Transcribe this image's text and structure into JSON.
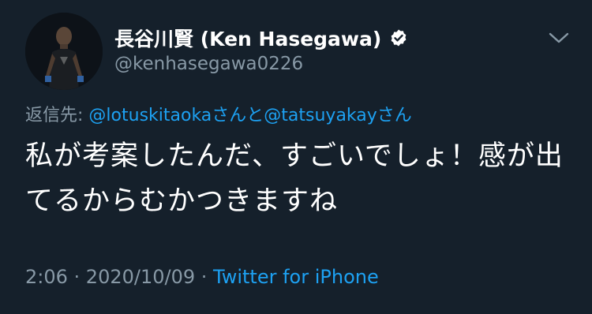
{
  "author": {
    "display_name": "長谷川賢 (Ken Hasegawa)",
    "handle": "@kenhasegawa0226",
    "verified": true
  },
  "reply": {
    "prefix": "返信先:",
    "user1": "@lotuskitaoka",
    "san1": "さんと",
    "user2": "@tatsuyakay",
    "san2": "さん"
  },
  "tweet": {
    "text": "私が考案したんだ、すごいでしょ！感が出てるからむかつきますね"
  },
  "meta": {
    "time": "2:06",
    "sep1": " · ",
    "date": "2020/10/09",
    "sep2": " · ",
    "source": "Twitter for iPhone"
  },
  "icons": {
    "verified": "verified-badge-icon",
    "menu": "chevron-down-icon"
  },
  "colors": {
    "background": "#15202b",
    "accent": "#1da1f2",
    "secondary_text": "#8899a6"
  }
}
